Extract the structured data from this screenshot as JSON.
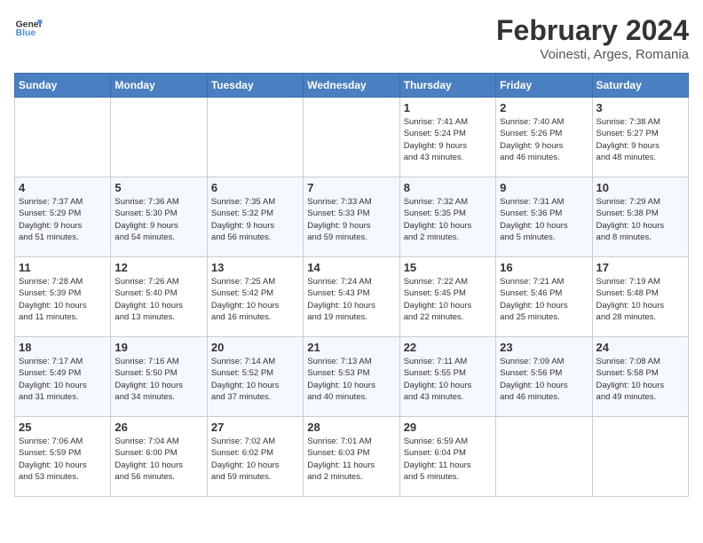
{
  "header": {
    "logo_text_general": "General",
    "logo_text_blue": "Blue",
    "title": "February 2024",
    "subtitle": "Voinesti, Arges, Romania"
  },
  "weekdays": [
    "Sunday",
    "Monday",
    "Tuesday",
    "Wednesday",
    "Thursday",
    "Friday",
    "Saturday"
  ],
  "weeks": [
    [
      {
        "day": "",
        "info": ""
      },
      {
        "day": "",
        "info": ""
      },
      {
        "day": "",
        "info": ""
      },
      {
        "day": "",
        "info": ""
      },
      {
        "day": "1",
        "info": "Sunrise: 7:41 AM\nSunset: 5:24 PM\nDaylight: 9 hours\nand 43 minutes."
      },
      {
        "day": "2",
        "info": "Sunrise: 7:40 AM\nSunset: 5:26 PM\nDaylight: 9 hours\nand 46 minutes."
      },
      {
        "day": "3",
        "info": "Sunrise: 7:38 AM\nSunset: 5:27 PM\nDaylight: 9 hours\nand 48 minutes."
      }
    ],
    [
      {
        "day": "4",
        "info": "Sunrise: 7:37 AM\nSunset: 5:29 PM\nDaylight: 9 hours\nand 51 minutes."
      },
      {
        "day": "5",
        "info": "Sunrise: 7:36 AM\nSunset: 5:30 PM\nDaylight: 9 hours\nand 54 minutes."
      },
      {
        "day": "6",
        "info": "Sunrise: 7:35 AM\nSunset: 5:32 PM\nDaylight: 9 hours\nand 56 minutes."
      },
      {
        "day": "7",
        "info": "Sunrise: 7:33 AM\nSunset: 5:33 PM\nDaylight: 9 hours\nand 59 minutes."
      },
      {
        "day": "8",
        "info": "Sunrise: 7:32 AM\nSunset: 5:35 PM\nDaylight: 10 hours\nand 2 minutes."
      },
      {
        "day": "9",
        "info": "Sunrise: 7:31 AM\nSunset: 5:36 PM\nDaylight: 10 hours\nand 5 minutes."
      },
      {
        "day": "10",
        "info": "Sunrise: 7:29 AM\nSunset: 5:38 PM\nDaylight: 10 hours\nand 8 minutes."
      }
    ],
    [
      {
        "day": "11",
        "info": "Sunrise: 7:28 AM\nSunset: 5:39 PM\nDaylight: 10 hours\nand 11 minutes."
      },
      {
        "day": "12",
        "info": "Sunrise: 7:26 AM\nSunset: 5:40 PM\nDaylight: 10 hours\nand 13 minutes."
      },
      {
        "day": "13",
        "info": "Sunrise: 7:25 AM\nSunset: 5:42 PM\nDaylight: 10 hours\nand 16 minutes."
      },
      {
        "day": "14",
        "info": "Sunrise: 7:24 AM\nSunset: 5:43 PM\nDaylight: 10 hours\nand 19 minutes."
      },
      {
        "day": "15",
        "info": "Sunrise: 7:22 AM\nSunset: 5:45 PM\nDaylight: 10 hours\nand 22 minutes."
      },
      {
        "day": "16",
        "info": "Sunrise: 7:21 AM\nSunset: 5:46 PM\nDaylight: 10 hours\nand 25 minutes."
      },
      {
        "day": "17",
        "info": "Sunrise: 7:19 AM\nSunset: 5:48 PM\nDaylight: 10 hours\nand 28 minutes."
      }
    ],
    [
      {
        "day": "18",
        "info": "Sunrise: 7:17 AM\nSunset: 5:49 PM\nDaylight: 10 hours\nand 31 minutes."
      },
      {
        "day": "19",
        "info": "Sunrise: 7:16 AM\nSunset: 5:50 PM\nDaylight: 10 hours\nand 34 minutes."
      },
      {
        "day": "20",
        "info": "Sunrise: 7:14 AM\nSunset: 5:52 PM\nDaylight: 10 hours\nand 37 minutes."
      },
      {
        "day": "21",
        "info": "Sunrise: 7:13 AM\nSunset: 5:53 PM\nDaylight: 10 hours\nand 40 minutes."
      },
      {
        "day": "22",
        "info": "Sunrise: 7:11 AM\nSunset: 5:55 PM\nDaylight: 10 hours\nand 43 minutes."
      },
      {
        "day": "23",
        "info": "Sunrise: 7:09 AM\nSunset: 5:56 PM\nDaylight: 10 hours\nand 46 minutes."
      },
      {
        "day": "24",
        "info": "Sunrise: 7:08 AM\nSunset: 5:58 PM\nDaylight: 10 hours\nand 49 minutes."
      }
    ],
    [
      {
        "day": "25",
        "info": "Sunrise: 7:06 AM\nSunset: 5:59 PM\nDaylight: 10 hours\nand 53 minutes."
      },
      {
        "day": "26",
        "info": "Sunrise: 7:04 AM\nSunset: 6:00 PM\nDaylight: 10 hours\nand 56 minutes."
      },
      {
        "day": "27",
        "info": "Sunrise: 7:02 AM\nSunset: 6:02 PM\nDaylight: 10 hours\nand 59 minutes."
      },
      {
        "day": "28",
        "info": "Sunrise: 7:01 AM\nSunset: 6:03 PM\nDaylight: 11 hours\nand 2 minutes."
      },
      {
        "day": "29",
        "info": "Sunrise: 6:59 AM\nSunset: 6:04 PM\nDaylight: 11 hours\nand 5 minutes."
      },
      {
        "day": "",
        "info": ""
      },
      {
        "day": "",
        "info": ""
      }
    ]
  ]
}
